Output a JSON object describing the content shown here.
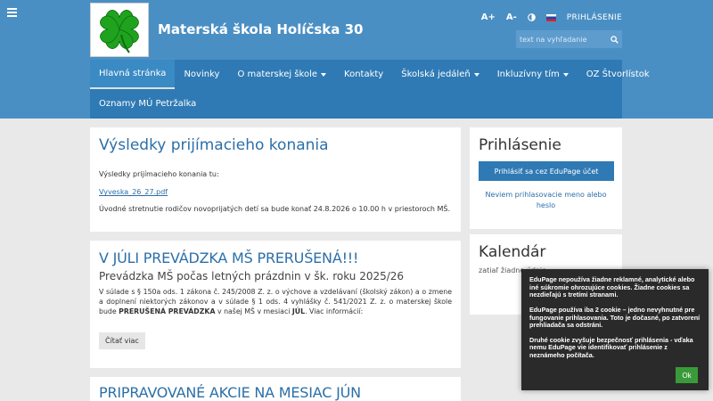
{
  "site": {
    "title": "Materská škola Holíčska 30"
  },
  "tools": {
    "font_plus": "A+",
    "font_minus": "A-",
    "login": "PRIHLÁSENIE"
  },
  "search": {
    "placeholder": "text na vyhľadanie"
  },
  "nav": {
    "items": [
      {
        "label": "Hlavná stránka",
        "active": true,
        "dropdown": false
      },
      {
        "label": "Novinky",
        "dropdown": false
      },
      {
        "label": "O materskej škole",
        "dropdown": true
      },
      {
        "label": "Kontakty",
        "dropdown": false
      },
      {
        "label": "Školská jedáleň",
        "dropdown": true
      },
      {
        "label": "Inkluzívny tím",
        "dropdown": true
      },
      {
        "label": "OZ Štvorlístok",
        "dropdown": false
      },
      {
        "label": "Oznamy MÚ Petržalka",
        "dropdown": false
      }
    ]
  },
  "post1": {
    "title": "Výsledky prijímacieho konania",
    "intro": "Výsledky prijímacieho konania tu:",
    "link": "Vyveska_26_27.pdf",
    "note": "Úvodné stretnutie rodičov novoprijatých detí sa bude konať 24.8.2026 o 10.00 h v priestoroch MŠ."
  },
  "post2": {
    "title": "V JÚLI PREVÁDZKA MŠ PRERUŠENÁ!!!",
    "subtitle": "Prevádzka MŠ počas letných prázdnin v šk. roku 2025/26",
    "body_a": "V súlade s § 150a ods. 1 zákona č. 245/2008 Z. z. o výchove a vzdelávaní (školský zákon) a o zmene a doplnení niektorých zákonov a v súlade § 1 ods. 4 vyhlášky č. 541/2021 Z. z. o materskej škole bude ",
    "body_bold": "PRERUŠENÁ PREVÁDZKA",
    "body_b": " v našej MŠ v mesiaci ",
    "body_bold2": "JÚL",
    "body_c": ". Viac informácií:",
    "read_more": "Čítať viac"
  },
  "post3": {
    "title": "PRIPRAVOVANÉ AKCIE NA MESIAC JÚN"
  },
  "login_box": {
    "title": "Prihlásenie",
    "button": "Prihlásiť sa cez EduPage účet",
    "forgot": "Neviem prihlasovacie meno alebo heslo"
  },
  "calendar": {
    "title": "Kalendár",
    "empty": "zatiaľ žiadne údaje"
  },
  "cookie": {
    "p1": "EduPage nepoužíva žiadne reklamné, analytické alebo iné súkromie ohrozujúce cookies. Žiadne cookies sa nezdieľajú s tretími stranami.",
    "p2": "EduPage používa iba 2 cookie – jedno nevyhnutné pre fungovanie prihlasovania. Toto je dočasné, po zatvorení prehliadača sa odstráni.",
    "p3": "Druhé cookie zvyšuje bezpečnosť prihlásenia - vďaka nemu EduPage vie identifikovať prihlásenie z neznámeho počítača.",
    "ok": "Ok"
  },
  "colors": {
    "header": "#4a8fc4",
    "nav": "#2f7ab4",
    "accent": "#2c6fa8",
    "ok": "#3a9a3a"
  },
  "icons": {
    "menu": "hamburger-icon",
    "logo": "four-leaf-clover-icon",
    "contrast": "contrast-icon",
    "flag": "slovak-flag-icon",
    "search": "search-icon"
  }
}
